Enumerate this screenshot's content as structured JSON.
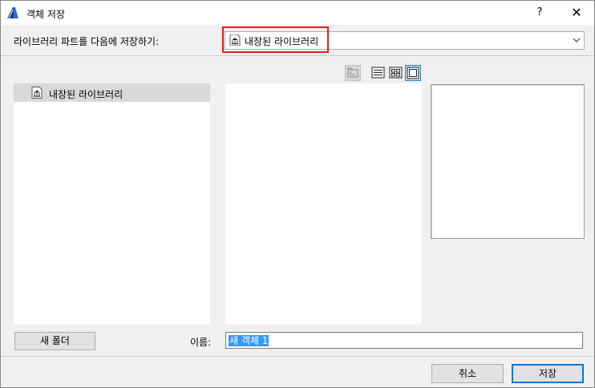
{
  "window": {
    "title": "객체 저장",
    "help_label": "?",
    "close_label": "✕",
    "app_icon": "archicad-logo-icon"
  },
  "location": {
    "label": "라이브러리 파트를 다음에 저장하기:",
    "selected": "내장된 라이브러리",
    "icon": "library-building-icon",
    "highlight_color": "#e02020"
  },
  "toolbar": {
    "buttons": [
      {
        "name": "folder-up",
        "icon": "folder-up-icon",
        "state": "disabled"
      },
      {
        "name": "list-view",
        "icon": "list-view-icon",
        "state": "normal"
      },
      {
        "name": "thumbnail-view",
        "icon": "grid-view-icon",
        "state": "normal"
      },
      {
        "name": "preview-view",
        "icon": "preview-view-icon",
        "state": "active"
      }
    ]
  },
  "tree": {
    "items": [
      {
        "label": "내장된 라이브러리",
        "icon": "library-building-icon",
        "selected": true
      }
    ]
  },
  "form": {
    "new_folder_label": "새 폴더",
    "name_label": "이름:",
    "name_value": "새 객체 1"
  },
  "footer": {
    "cancel_label": "취소",
    "save_label": "저장",
    "accent_color": "#0078d7"
  }
}
